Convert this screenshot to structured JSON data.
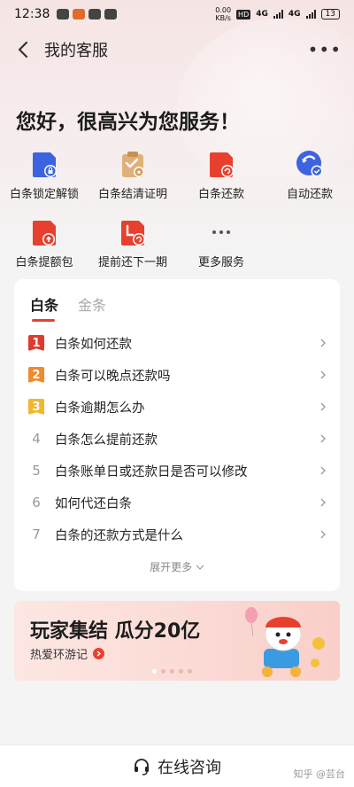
{
  "status_bar": {
    "time": "12:38",
    "net_speed_value": "0.00",
    "net_speed_unit": "KB/s",
    "sim1": "HD",
    "sig1": "4G",
    "sig2": "4G",
    "battery": "13"
  },
  "nav": {
    "title": "我的客服",
    "more_label": "•••"
  },
  "greeting": "您好，很高兴为您服务！",
  "services": [
    {
      "label": "白条锁定解锁",
      "icon": "lock-card-icon",
      "color": "#e8402f"
    },
    {
      "label": "白条结清证明",
      "icon": "certificate-icon",
      "color": "#d9a86a"
    },
    {
      "label": "白条还款",
      "icon": "repay-card-icon",
      "color": "#e8402f"
    },
    {
      "label": "自动还款",
      "icon": "auto-repay-icon",
      "color": "#3c63e0"
    },
    {
      "label": "白条提额包",
      "icon": "limit-boost-icon",
      "color": "#e8402f"
    },
    {
      "label": "提前还下一期",
      "icon": "early-repay-icon",
      "color": "#e8402f"
    },
    {
      "label": "更多服务",
      "icon": "more-dots-icon",
      "color": "#555555"
    }
  ],
  "faq_card": {
    "tabs": [
      {
        "label": "白条",
        "active": true
      },
      {
        "label": "金条",
        "active": false
      }
    ],
    "items": [
      {
        "rank": "1",
        "text": "白条如何还款"
      },
      {
        "rank": "2",
        "text": "白条可以晚点还款吗"
      },
      {
        "rank": "3",
        "text": "白条逾期怎么办"
      },
      {
        "rank": "4",
        "text": "白条怎么提前还款"
      },
      {
        "rank": "5",
        "text": "白条账单日或还款日是否可以修改"
      },
      {
        "rank": "6",
        "text": "如何代还白条"
      },
      {
        "rank": "7",
        "text": "白条的还款方式是什么"
      }
    ],
    "expand_label": "展开更多"
  },
  "banner": {
    "headline": "玩家集结 瓜分20亿",
    "sub": "热爱环游记"
  },
  "bottom": {
    "label": "在线咨询"
  },
  "watermark": "知乎 @芸台",
  "colors": {
    "accent": "#e8402f",
    "blue": "#3c63e0"
  }
}
